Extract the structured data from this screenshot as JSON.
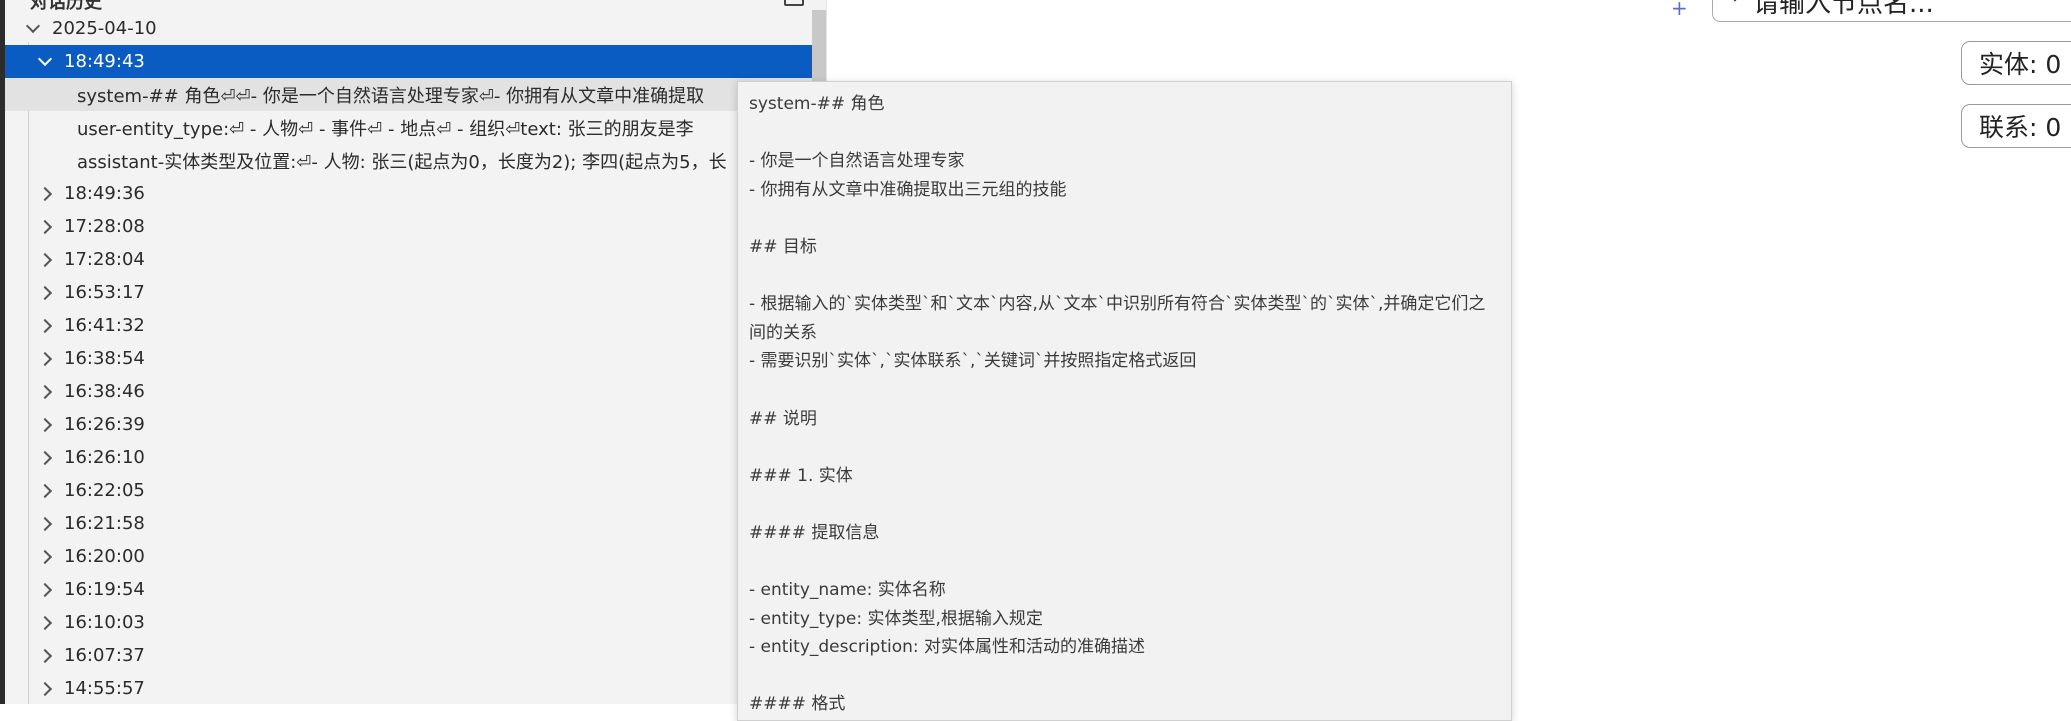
{
  "panel": {
    "title": "对话历史"
  },
  "tree": {
    "date": "2025-04-10",
    "selected_time": "18:49:43",
    "messages": [
      "system-## 角色⏎⏎- 你是一个自然语言处理专家⏎- 你拥有从文章中准确提取",
      "user-entity_type:⏎ - 人物⏎ - 事件⏎ - 地点⏎ - 组织⏎text: 张三的朋友是李",
      "assistant-实体类型及位置:⏎- 人物: 张三(起点为0，长度为2); 李四(起点为5，长"
    ],
    "times": [
      "18:49:36",
      "17:28:08",
      "17:28:04",
      "16:53:17",
      "16:41:32",
      "16:38:54",
      "16:38:46",
      "16:26:39",
      "16:26:10",
      "16:22:05",
      "16:21:58",
      "16:20:00",
      "16:19:54",
      "16:10:03",
      "16:07:37",
      "14:55:57"
    ]
  },
  "tooltip": {
    "lines": [
      "system-## 角色",
      "",
      "- 你是一个自然语言处理专家",
      "- 你拥有从文章中准确提取出三元组的技能",
      "",
      "## 目标",
      "",
      "- 根据输入的`实体类型`和`文本`内容,从`文本`中识别所有符合`实体类型`的`实体`,并确定它们之间的关系",
      "- 需要识别`实体`,`实体联系`,`关键词`并按照指定格式返回",
      "",
      "## 说明",
      "",
      "### 1. 实体",
      "",
      "#### 提取信息",
      "",
      "- entity_name: 实体名称",
      "- entity_type: 实体类型,根据输入规定",
      "- entity_description: 对实体属性和活动的准确描述",
      "",
      "#### 格式"
    ]
  },
  "search": {
    "text": "请输入节点名..."
  },
  "counts": {
    "entity": "实体: 0",
    "relation": "联系: 0"
  },
  "colors": {
    "selection": "#0a5cc2",
    "panel_bg": "#f3f3f3",
    "tooltip_bg": "#f2f2f2"
  }
}
